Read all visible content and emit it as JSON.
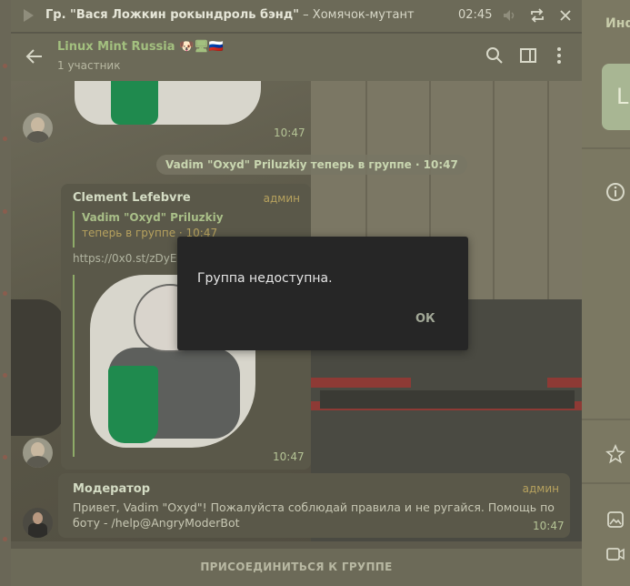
{
  "player": {
    "track_group": "Гр. \"Вася Ложкин рокындроль бэнд\"",
    "track_separator": " – ",
    "track_title": "Хомячок-мутант",
    "time": "02:45",
    "icons": [
      "play-icon",
      "volume-icon",
      "repeat-icon",
      "close-icon"
    ]
  },
  "header": {
    "title": "Linux Mint Russia",
    "emoji": "🐶🖥🇷🇺",
    "subtitle": "1 участник",
    "icons": [
      "back-arrow-icon",
      "search-icon",
      "sidebar-toggle-icon",
      "more-vert-icon"
    ]
  },
  "messages": {
    "top_sticker_time": "10:47",
    "service": "Vadim \"Oxyd\" Priluzkiy теперь в группе · 10:47",
    "clement": {
      "author": "Clement Lefebvre",
      "role": "админ",
      "reply_name": "Vadim \"Oxyd\" Priluzkiy",
      "reply_text": "теперь в группе · 10:47",
      "link": "https://0x0.st/zDyE",
      "time": "10:47"
    },
    "moderator": {
      "author": "Модератор",
      "role": "админ",
      "text": "Привет, Vadim \"Oxyd\"! Пожалуйста соблюдай правила и не ругайся. Помощь по боту - /help@AngryModerBot",
      "time": "10:47"
    }
  },
  "join": {
    "label": "ПРИСОЕДИНИТЬСЯ К ГРУППЕ"
  },
  "dialog": {
    "message": "Группа недоступна.",
    "ok": "ОК"
  },
  "right_pane": {
    "title": "Инфо",
    "card_letter": "L",
    "icons": [
      "info-icon",
      "star-icon",
      "photo-icon",
      "video-icon"
    ]
  },
  "colors": {
    "accent_green": "#a3c07f",
    "admin_gold": "#b7a25e",
    "dialog_bg": "#262626"
  }
}
